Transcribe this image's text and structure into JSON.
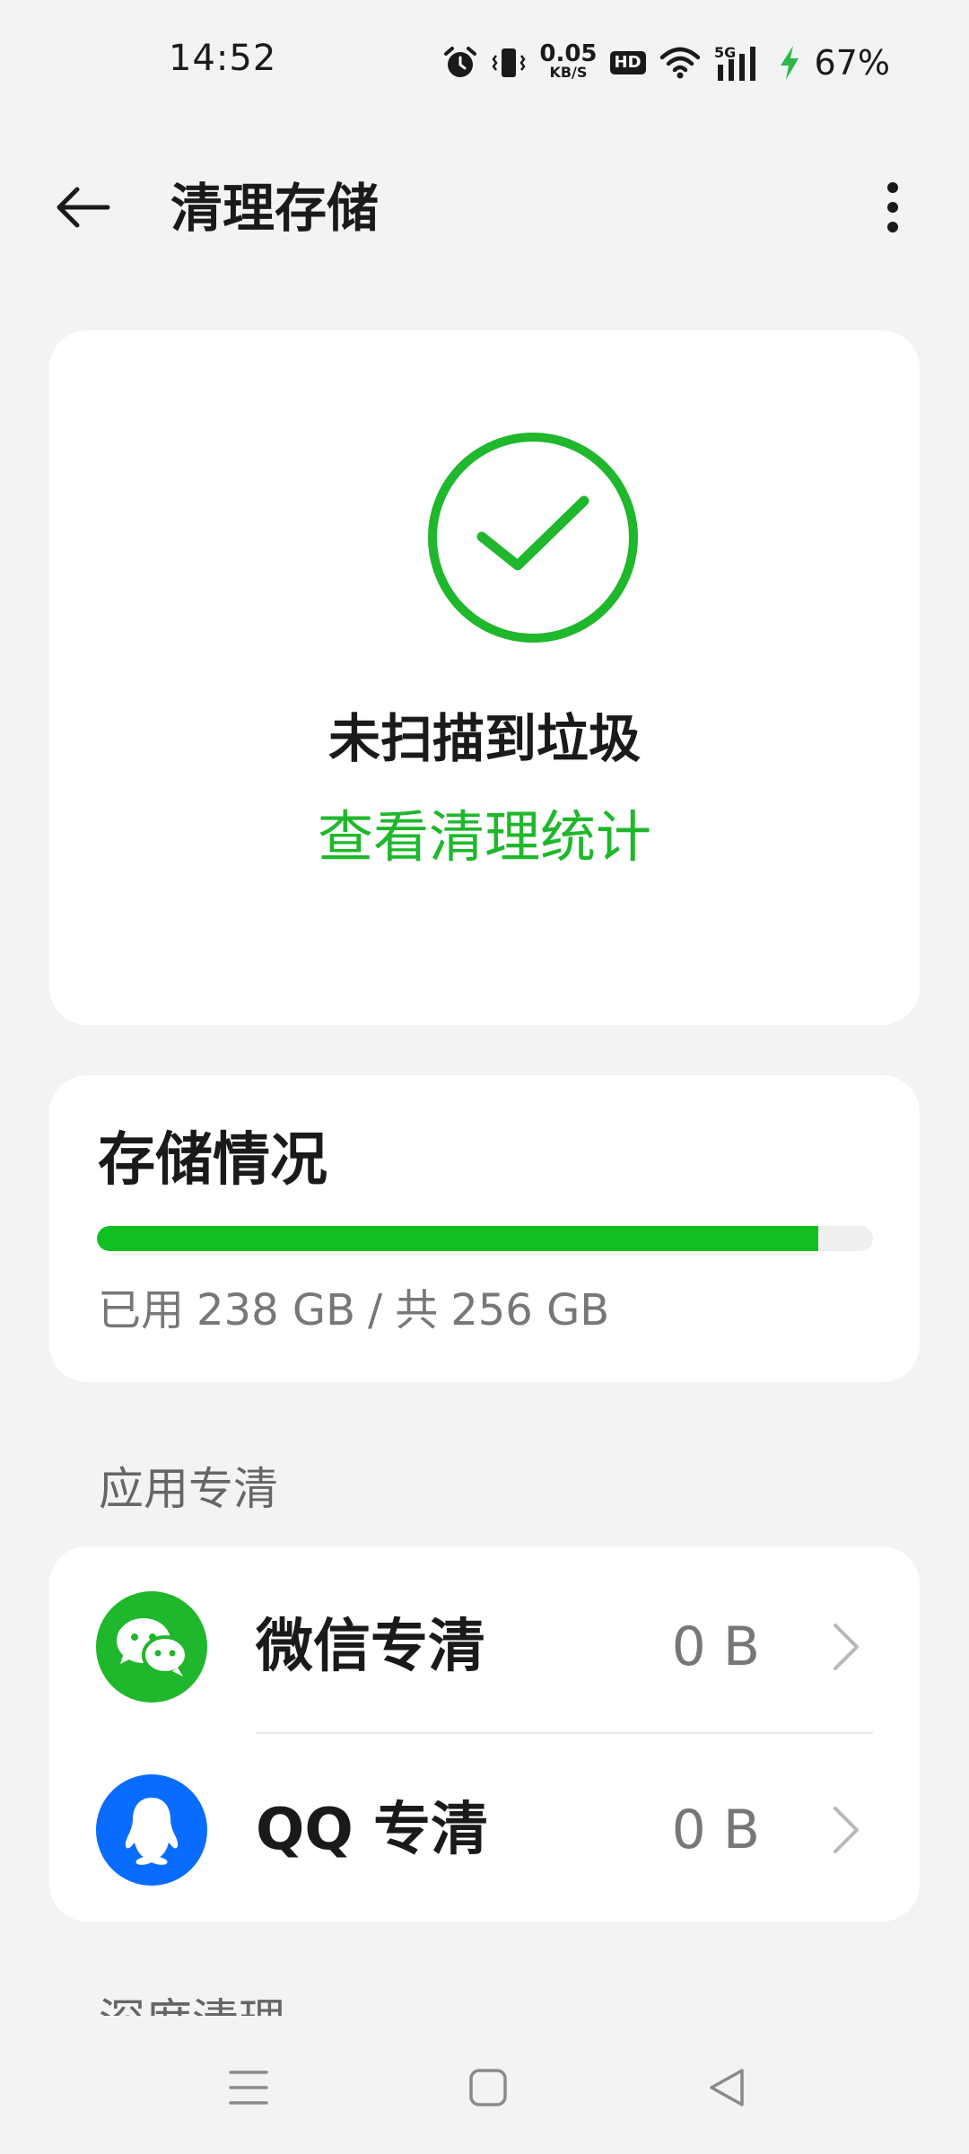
{
  "status_bar": {
    "time": "14:52",
    "net_speed_value": "0.05",
    "net_speed_unit": "KB/S",
    "hd_badge": "HD",
    "network_type": "5G",
    "battery": "67%",
    "icons": [
      "alarm-icon",
      "vibrate-icon",
      "wifi-icon",
      "signal-icon",
      "charging-icon"
    ]
  },
  "app_bar": {
    "title": "清理存储",
    "back_icon": "arrow-left-icon",
    "more_icon": "more-vertical-icon"
  },
  "scan_card": {
    "icon": "check-circle-icon",
    "title": "未扫描到垃圾",
    "link": "查看清理统计"
  },
  "storage_card": {
    "title": "存储情况",
    "used_label": "已用",
    "used_value": "238 GB",
    "separator": "/",
    "total_label": "共",
    "total_value": "256 GB",
    "used_fraction": 0.93
  },
  "app_clean_section": {
    "label": "应用专清",
    "items": [
      {
        "name": "微信专清",
        "size": "0 B",
        "icon": "wechat-icon"
      },
      {
        "name": "QQ 专清",
        "size": "0 B",
        "icon": "qq-icon"
      }
    ]
  },
  "next_section_label": "深度清理",
  "colors": {
    "accent_green": "#1fb72b",
    "progress_green": "#10c021",
    "qq_blue": "#0a6cff",
    "background": "#f2f3f5"
  },
  "nav_bar": {
    "icons": [
      "menu-icon",
      "home-square-icon",
      "back-triangle-icon"
    ]
  }
}
